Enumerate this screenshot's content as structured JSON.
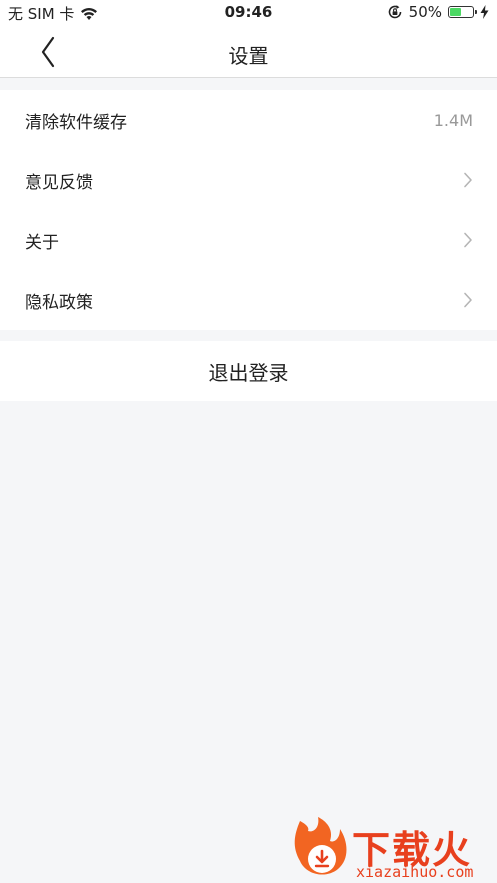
{
  "status_bar": {
    "carrier": "无 SIM 卡",
    "time": "09:46",
    "battery_percent": "50%",
    "battery_level": 0.5,
    "battery_color": "#4cd964"
  },
  "nav": {
    "title": "设置",
    "back_icon": "chevron-left-icon"
  },
  "settings": {
    "items": [
      {
        "label": "清除软件缓存",
        "value": "1.4M"
      },
      {
        "label": "意见反馈",
        "icon": "chevron-right-icon"
      },
      {
        "label": "关于",
        "icon": "chevron-right-icon"
      },
      {
        "label": "隐私政策",
        "icon": "chevron-right-icon"
      }
    ]
  },
  "logout": {
    "label": "退出登录"
  },
  "watermark": {
    "name": "下载火",
    "domain": "xiazaihuo.com",
    "brand_color": "#e8401e"
  }
}
